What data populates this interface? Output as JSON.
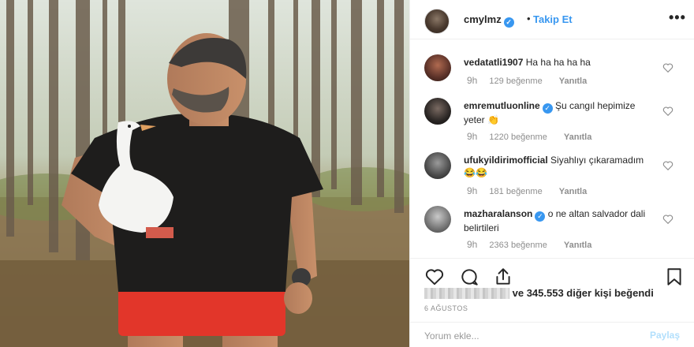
{
  "post": {
    "photo_description_icon": "photo",
    "header": {
      "username": "cmylmz",
      "verified": true,
      "separator": "•",
      "follow_label": "Takip Et",
      "more_label": "•••"
    },
    "comments": [
      {
        "username": "vedatatli1907",
        "verified": false,
        "text": "Ha ha ha ha ha",
        "time": "9h",
        "likes": "129 beğenme",
        "reply": "Yanıtla"
      },
      {
        "username": "emremutluonline",
        "verified": true,
        "text": "Şu cangıl hepimize yeter 👏",
        "time": "9h",
        "likes": "1220 beğenme",
        "reply": "Yanıtla"
      },
      {
        "username": "ufukyildirimofficial",
        "verified": false,
        "text": "Siyahlıyı çıkaramadım😂😂",
        "time": "9h",
        "likes": "181 beğenme",
        "reply": "Yanıtla"
      },
      {
        "username": "mazharalanson",
        "verified": true,
        "text": "o ne altan salvador dali belirtileri",
        "time": "9h",
        "likes": "2363 beğenme",
        "reply": "Yanıtla"
      }
    ],
    "likes_text": "ve 345.553 diğer kişi beğendi",
    "date": "6 AĞUSTOS",
    "comment_placeholder": "Yorum ekle...",
    "post_label": "Paylaş",
    "colors": {
      "accent": "#3897f0",
      "post_disabled": "#b2dffc",
      "meta": "#8e8e8e"
    }
  }
}
